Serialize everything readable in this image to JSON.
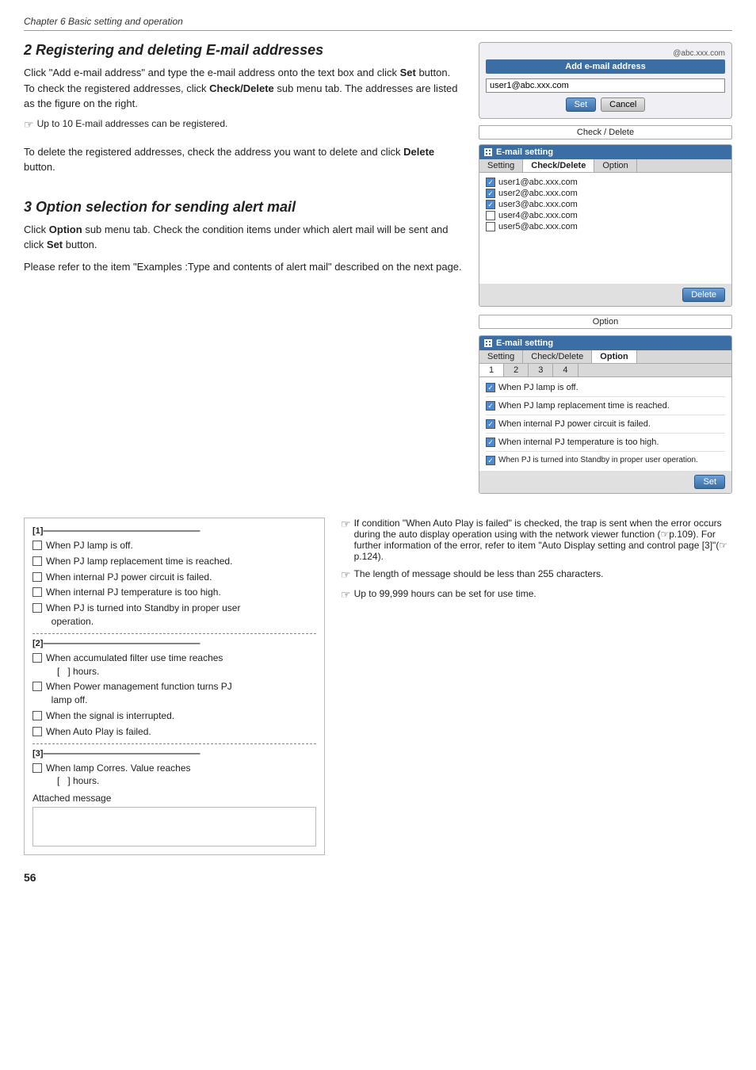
{
  "chapter": {
    "title": "Chapter 6 Basic setting and operation"
  },
  "section2": {
    "title": "2 Registering and deleting E-mail addresses",
    "para1": "Click \"Add e-mail address\" and type the e-mail address onto the text box and click",
    "para1_bold": "Set",
    "para1_rest": "button. To check the registered addresses, click",
    "para1_bold2": "Check/Delete",
    "para1_rest2": "sub menu tab. The addresses are listed as the figure on the right.",
    "note1": "Up to 10 E-mail addresses can be registered.",
    "para2_pre": "To delete the registered addresses, check the address you want to delete and click",
    "para2_bold": "Delete",
    "para2_rest": "button.",
    "add_email_header": "Add e-mail address",
    "domain_hint": "@abc.xxx.com",
    "input_value": "user1@abc.xxx.com",
    "btn_set": "Set",
    "btn_cancel": "Cancel",
    "check_delete_label": "Check / Delete",
    "email_setting_header": "E-mail setting",
    "tabs": [
      "Setting",
      "Check/Delete",
      "Option"
    ],
    "email_list": [
      {
        "address": "user1@abc.xxx.com",
        "checked": true
      },
      {
        "address": "user2@abc.xxx.com",
        "checked": true
      },
      {
        "address": "user3@abc.xxx.com",
        "checked": true
      },
      {
        "address": "user4@abc.xxx.com",
        "checked": false
      },
      {
        "address": "user5@abc.xxx.com",
        "checked": false
      }
    ],
    "btn_delete": "Delete"
  },
  "section3": {
    "title": "3 Option selection for sending alert mail",
    "para1_pre": "Click",
    "para1_bold": "Option",
    "para1_rest": "sub menu tab. Check the condition items under which alert mail will be sent and click",
    "para1_bold2": "Set",
    "para1_rest2": "button.",
    "para2": "Please refer to the item \"Examples :Type and contents of alert mail\" described on the next page.",
    "option_label": "Option",
    "email_setting2_header": "E-mail setting",
    "tabs2": [
      "Setting",
      "Check/Delete",
      "Option"
    ],
    "num_tabs": [
      "1",
      "2",
      "3",
      "4"
    ],
    "option_items": [
      {
        "label": "When PJ lamp is off.",
        "checked": true
      },
      {
        "label": "When PJ lamp replacement time is reached.",
        "checked": true
      },
      {
        "label": "When internal PJ power circuit is failed.",
        "checked": true
      },
      {
        "label": "When internal PJ temperature is too high.",
        "checked": true
      },
      {
        "label": "When PJ is turned into Standby in proper user operation.",
        "checked": true
      }
    ],
    "btn_set2": "Set"
  },
  "bottom_left": {
    "group1_label": "[1]——————————————————",
    "group1_items": [
      "When PJ lamp is off.",
      "When PJ lamp replacement time is reached.",
      "When internal PJ power circuit is failed.",
      "When internal PJ temperature is too high.",
      "When PJ is turned into Standby in proper user operation."
    ],
    "group2_label": "[2]——————————————————",
    "group2_items": [
      "When accumulated filter use time reaches [   ] hours.",
      "When Power management function turns PJ lamp off.",
      "When the signal is interrupted.",
      "When Auto Play is failed."
    ],
    "group3_label": "[3]——————————————————",
    "group3_items": [
      "When lamp Corres. Value reaches [   ] hours."
    ],
    "attached_label": "Attached message"
  },
  "bottom_right": {
    "note1": "If condition \"When Auto Play is failed\" is checked, the trap is sent when the error occurs during the auto display operation using with the network viewer function (☞p.109). For further information of the error, refer to item \"Auto Display setting and control page [3]\"(☞p.124).",
    "note2": "The length of message should be less than 255 characters.",
    "note3": "Up to 99,999 hours can be set for use time."
  },
  "page_number": "56"
}
